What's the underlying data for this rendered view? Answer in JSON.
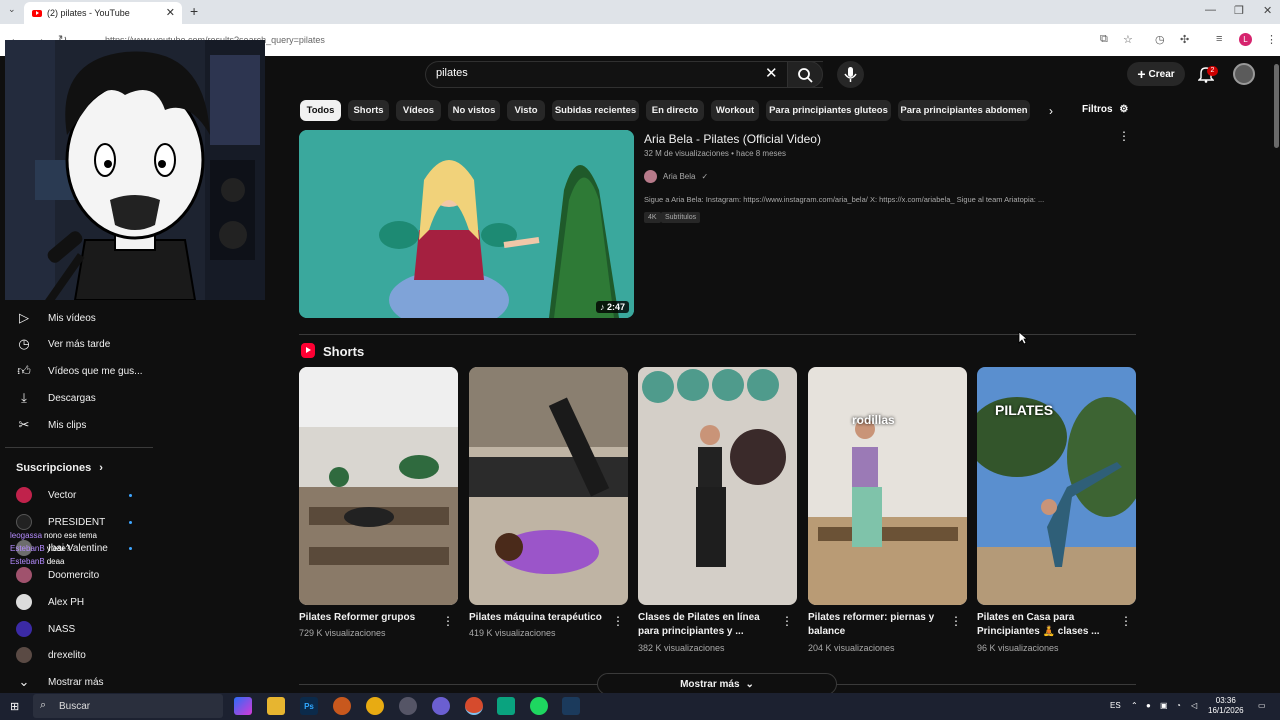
{
  "browser": {
    "tab_title": "(2) pilates - YouTube",
    "url": "https://www.youtube.com/results?search_query=pilates",
    "profile_initial": "L"
  },
  "header": {
    "search_value": "pilates",
    "create_label": "Crear",
    "notif_count": "2"
  },
  "chips": [
    "Todos",
    "Shorts",
    "Vídeos",
    "No vistos",
    "Visto",
    "Subidas recientes",
    "En directo",
    "Workout",
    "Para principiantes gluteos",
    "Para principiantes abdomen"
  ],
  "filters_label": "Filtros",
  "sidebar": {
    "items": [
      {
        "label": "Mis vídeos",
        "icon": "play-box-icon"
      },
      {
        "label": "Ver más tarde",
        "icon": "clock-icon"
      },
      {
        "label": "Vídeos que me gus...",
        "icon": "thumb-up-icon"
      },
      {
        "label": "Descargas",
        "icon": "download-icon"
      },
      {
        "label": "Mis clips",
        "icon": "scissors-icon"
      }
    ],
    "subs_title": "Suscripciones",
    "subs": [
      {
        "name": "Vector",
        "color": "#c0224b"
      },
      {
        "name": "PRESIDENT",
        "color": "#222222"
      },
      {
        "name": "Ibai Valentine",
        "color": "#6d6d6d"
      },
      {
        "name": "Doomercito",
        "color": "#a0526d"
      },
      {
        "name": "Alex PH",
        "color": "#dcdcdc"
      },
      {
        "name": "NASS",
        "color": "#3b2aa5"
      },
      {
        "name": "drexelito",
        "color": "#5a4a44"
      }
    ],
    "more_label": "Mostrar más"
  },
  "chat": [
    {
      "user": "leogassa",
      "msg": "nono ese tema"
    },
    {
      "user": "EstebanB",
      "msg": "y ese?"
    },
    {
      "user": "EstebanB",
      "msg": "deaa"
    }
  ],
  "main_video": {
    "title": "Aria Bela - Pilates (Official Video)",
    "meta": "32 M de visualizaciones • hace 8 meses",
    "channel": "Aria Bela",
    "description": "Sigue a Aria Bela: Instagram: https://www.instagram.com/aria_bela/ X: https://x.com/ariabela_ Sigue al team Ariatopia: ...",
    "badges": [
      "4K",
      "Subtítulos"
    ],
    "duration": "2:47"
  },
  "shorts_title": "Shorts",
  "shorts": [
    {
      "title": "Pilates Reformer grupos",
      "views": "729 K visualizaciones",
      "overlay": ""
    },
    {
      "title": "Pilates máquina terapéutico",
      "views": "419 K visualizaciones",
      "overlay": ""
    },
    {
      "title": "Clases de Pilates en línea para principiantes y ...",
      "views": "382 K visualizaciones",
      "overlay": ""
    },
    {
      "title": "Pilates reformer: piernas y balance",
      "views": "204 K visualizaciones",
      "overlay": "rodillas"
    },
    {
      "title": "Pilates en Casa para Principiantes 🧘 clases ...",
      "views": "96 K visualizaciones",
      "overlay": "PILATES"
    }
  ],
  "show_more_label": "Mostrar más",
  "taskbar": {
    "search_label": "Buscar",
    "lang": "ES",
    "time": "03:36",
    "date": "16/1/2026"
  }
}
